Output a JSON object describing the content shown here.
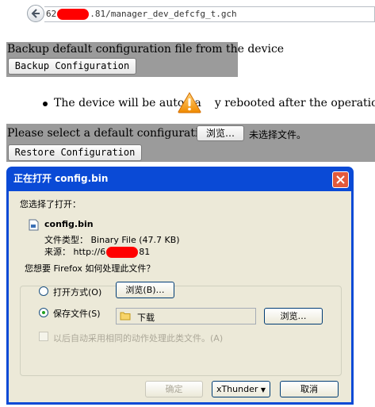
{
  "browser": {
    "url_prefix": "62",
    "url_suffix": ".81/manager_dev_defcfg_t.gch"
  },
  "backup": {
    "label": "Backup default configuration file from the device",
    "button": "Backup Configuration"
  },
  "note": {
    "text_before": "The device will be automa",
    "text_after": "y rebooted after the operation."
  },
  "restore": {
    "label": "Please select a default configuration file",
    "browse_button": "浏览…",
    "no_file_text": "未选择文件。",
    "button": "Restore Configuration"
  },
  "dialog": {
    "title": "正在打开 config.bin",
    "intro": "您选择了打开：",
    "filename": "config.bin",
    "file_type": "文件类型： Binary File (47.7 KB)",
    "source_prefix": "来源： http://6",
    "source_suffix": "81",
    "question": "您想要 Firefox 如何处理此文件？",
    "open_with_label": "打开方式(O)",
    "open_with_app": "浏览(B)…",
    "save_file_label": "保存文件(S)",
    "save_folder": "下载",
    "save_browse": "浏览…",
    "auto_label": "以后自动采用相同的动作处理此类文件。(A)",
    "ok_button": "确定",
    "xthunder_button": "xThunder",
    "cancel_button": "取消"
  }
}
